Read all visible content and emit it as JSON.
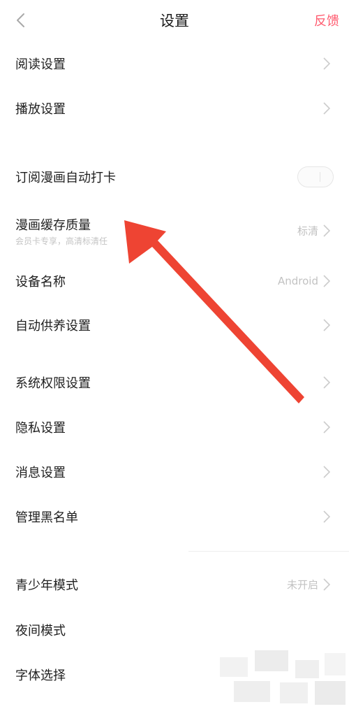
{
  "header": {
    "title": "设置",
    "feedback_label": "反馈",
    "accent_color": "#ff5a6e"
  },
  "items": [
    {
      "label": "阅读设置",
      "icon": "chevron-right-icon"
    },
    {
      "label": "播放设置",
      "icon": "chevron-right-icon"
    },
    {
      "label": "订阅漫画自动打卡",
      "control": "toggle",
      "toggle_on": false
    },
    {
      "label": "漫画缓存质量",
      "sublabel": "会员卡专享，高清标清任",
      "value": "标清",
      "icon": "chevron-right-icon"
    },
    {
      "label": "设备名称",
      "value": "Android",
      "icon": "chevron-right-icon"
    },
    {
      "label": "自动供养设置",
      "icon": "chevron-right-icon"
    },
    {
      "label": "系统权限设置",
      "icon": "chevron-right-icon"
    },
    {
      "label": "隐私设置",
      "icon": "chevron-right-icon"
    },
    {
      "label": "消息设置",
      "icon": "chevron-right-icon"
    },
    {
      "label": "管理黑名单",
      "icon": "chevron-right-icon"
    },
    {
      "label": "青少年模式",
      "value": "未开启",
      "icon": "chevron-right-icon"
    },
    {
      "label": "夜间模式"
    },
    {
      "label": "字体选择"
    }
  ],
  "annotation": {
    "icon": "red-arrow-icon",
    "color": "#ee4433"
  }
}
